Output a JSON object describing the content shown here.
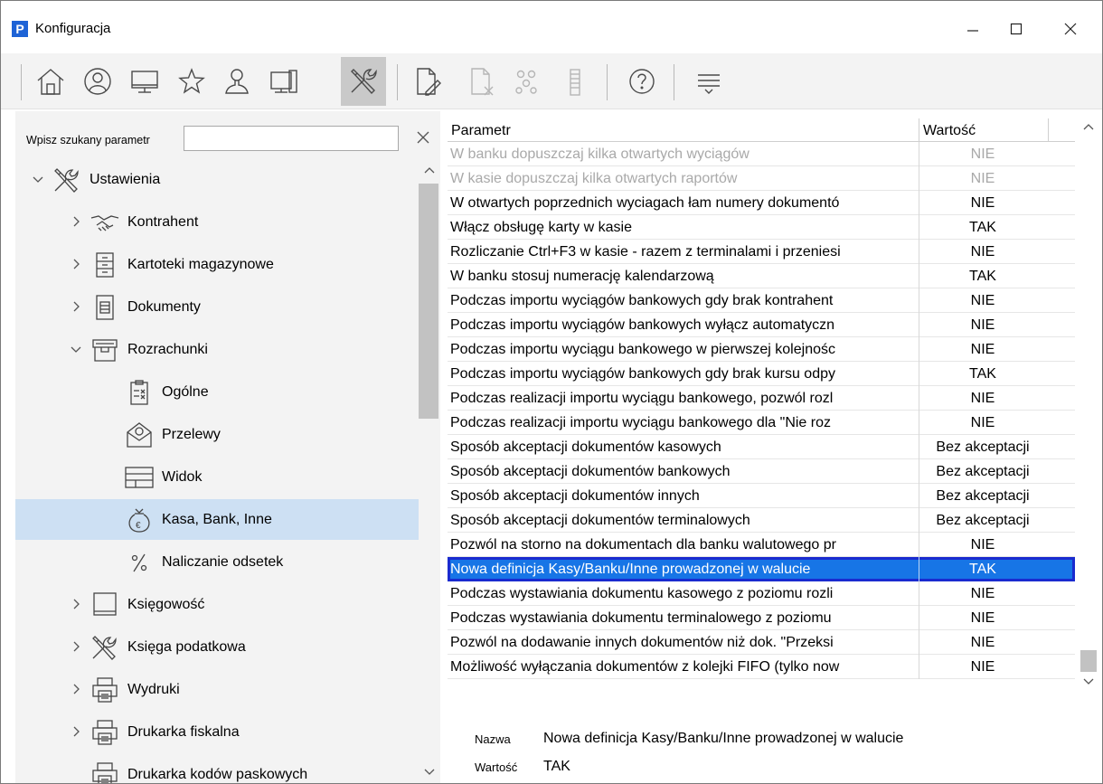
{
  "window": {
    "app_logo_letter": "P",
    "title": "Konfiguracja"
  },
  "toolbar": {
    "buttons": [
      {
        "icon": "home-icon",
        "enabled": true
      },
      {
        "icon": "user-circle-icon",
        "enabled": true
      },
      {
        "icon": "monitor-icon",
        "enabled": true
      },
      {
        "icon": "star-icon",
        "enabled": true
      },
      {
        "icon": "person-icon",
        "enabled": true
      },
      {
        "icon": "workstation-icon",
        "enabled": true
      },
      {
        "icon": "tools-icon",
        "enabled": true,
        "active": true
      },
      {
        "icon": "document-edit-icon",
        "enabled": true
      },
      {
        "icon": "document-delete-icon",
        "enabled": false
      },
      {
        "icon": "group-icon",
        "enabled": false
      },
      {
        "icon": "list-icon",
        "enabled": false
      },
      {
        "icon": "help-icon",
        "enabled": true
      },
      {
        "icon": "filter-icon",
        "enabled": true
      }
    ]
  },
  "search": {
    "label": "Wpisz szukany parametr",
    "value": ""
  },
  "tree": {
    "items": [
      {
        "label": "Ustawienia",
        "icon": "tools-icon",
        "level": 0,
        "chevron": "down"
      },
      {
        "label": "Kontrahent",
        "icon": "handshake-icon",
        "level": 1,
        "chevron": "right"
      },
      {
        "label": "Kartoteki magazynowe",
        "icon": "cabinet-icon",
        "level": 1,
        "chevron": "right"
      },
      {
        "label": "Dokumenty",
        "icon": "document-icon",
        "level": 1,
        "chevron": "right"
      },
      {
        "label": "Rozrachunki",
        "icon": "archive-box-icon",
        "level": 1,
        "chevron": "down"
      },
      {
        "label": "Ogólne",
        "icon": "clipboard-icon",
        "level": 2,
        "chevron": ""
      },
      {
        "label": "Przelewy",
        "icon": "envelope-money-icon",
        "level": 2,
        "chevron": ""
      },
      {
        "label": "Widok",
        "icon": "window-layout-icon",
        "level": 2,
        "chevron": ""
      },
      {
        "label": "Kasa, Bank, Inne",
        "icon": "money-bag-icon",
        "level": 2,
        "chevron": "",
        "selected": true
      },
      {
        "label": "Naliczanie odsetek",
        "icon": "percent-icon",
        "level": 2,
        "chevron": ""
      },
      {
        "label": "Księgowość",
        "icon": "book-icon",
        "level": 1,
        "chevron": "right"
      },
      {
        "label": "Księga podatkowa",
        "icon": "tools-icon",
        "level": 1,
        "chevron": "right"
      },
      {
        "label": "Wydruki",
        "icon": "printer-icon",
        "level": 1,
        "chevron": "right"
      },
      {
        "label": "Drukarka fiskalna",
        "icon": "printer-icon",
        "level": 1,
        "chevron": "right"
      },
      {
        "label": "Drukarka kodów paskowych",
        "icon": "printer-icon",
        "level": 1,
        "chevron": ""
      }
    ]
  },
  "grid": {
    "headers": {
      "param": "Parametr",
      "value": "Wartość"
    },
    "rows": [
      {
        "param": "W banku dopuszczaj kilka otwartych wyciągów",
        "value": "NIE",
        "disabled": true
      },
      {
        "param": "W kasie dopuszczaj kilka otwartych raportów",
        "value": "NIE",
        "disabled": true
      },
      {
        "param": "W otwartych poprzednich wyciagach łam numery dokumentó",
        "value": "NIE"
      },
      {
        "param": "Włącz obsługę karty w kasie",
        "value": "TAK"
      },
      {
        "param": "Rozliczanie Ctrl+F3 w kasie - razem z terminalami i przeniesi",
        "value": "NIE"
      },
      {
        "param": "W banku stosuj numerację kalendarzową",
        "value": "TAK"
      },
      {
        "param": "Podczas importu wyciągów bankowych gdy brak kontrahent",
        "value": "NIE"
      },
      {
        "param": "Podczas importu wyciągów bankowych wyłącz automatyczn",
        "value": "NIE"
      },
      {
        "param": "Podczas importu wyciągu bankowego w pierwszej kolejnośc",
        "value": "NIE"
      },
      {
        "param": "Podczas importu wyciągów bankowych gdy brak kursu odpy",
        "value": "TAK"
      },
      {
        "param": "Podczas realizacji importu wyciągu bankowego, pozwól rozl",
        "value": "NIE"
      },
      {
        "param": "Podczas realizacji importu wyciągu bankowego dla \"Nie roz",
        "value": "NIE"
      },
      {
        "param": "Sposób akceptacji dokumentów kasowych",
        "value": "Bez akceptacji"
      },
      {
        "param": "Sposób akceptacji dokumentów bankowych",
        "value": "Bez akceptacji"
      },
      {
        "param": "Sposób akceptacji dokumentów innych",
        "value": "Bez akceptacji"
      },
      {
        "param": "Sposób akceptacji dokumentów terminalowych",
        "value": "Bez akceptacji"
      },
      {
        "param": "Pozwól na storno na dokumentach dla banku walutowego pr",
        "value": "NIE"
      },
      {
        "param": "Nowa definicja Kasy/Banku/Inne prowadzonej w walucie",
        "value": "TAK",
        "selected": true
      },
      {
        "param": "Podczas wystawiania dokumentu kasowego z poziomu rozli",
        "value": "NIE"
      },
      {
        "param": "Podczas wystawiania dokumentu terminalowego z poziomu",
        "value": "NIE"
      },
      {
        "param": "Pozwól na dodawanie innych dokumentów niż dok. \"Przeksi",
        "value": "NIE"
      },
      {
        "param": "Możliwość wyłączania dokumentów z kolejki FIFO (tylko now",
        "value": "NIE"
      }
    ]
  },
  "detail": {
    "name_label": "Nazwa",
    "name_value": "Nowa definicja Kasy/Banku/Inne prowadzonej w walucie",
    "value_label": "Wartość",
    "value_value": "TAK"
  }
}
